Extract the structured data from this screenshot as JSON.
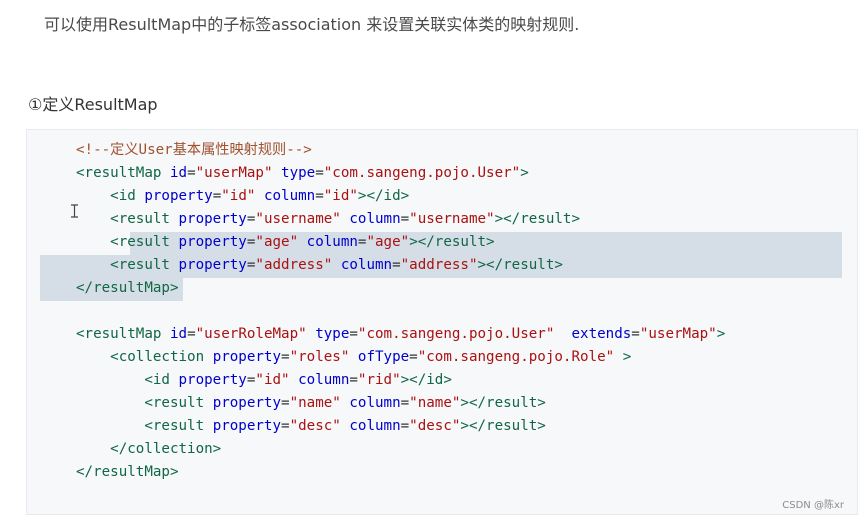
{
  "intro_text": "可以使用ResultMap中的子标签association 来设置关联实体类的映射规则.",
  "heading": "①定义ResultMap",
  "watermark": "CSDN @陈xr",
  "code_lines": [
    [
      [
        "comment",
        "<!--定义User基本属性映射规则-->"
      ]
    ],
    [
      [
        "tag",
        "<resultMap"
      ],
      [
        "plain",
        " "
      ],
      [
        "attr",
        "id"
      ],
      [
        "plain",
        "="
      ],
      [
        "val",
        "\"userMap\""
      ],
      [
        "plain",
        " "
      ],
      [
        "attr",
        "type"
      ],
      [
        "plain",
        "="
      ],
      [
        "val",
        "\"com.sangeng.pojo.User\""
      ],
      [
        "tag",
        ">"
      ]
    ],
    [
      [
        "plain",
        "    "
      ],
      [
        "tag",
        "<id"
      ],
      [
        "plain",
        " "
      ],
      [
        "attr",
        "property"
      ],
      [
        "plain",
        "="
      ],
      [
        "val",
        "\"id\""
      ],
      [
        "plain",
        " "
      ],
      [
        "attr",
        "column"
      ],
      [
        "plain",
        "="
      ],
      [
        "val",
        "\"id\""
      ],
      [
        "tag",
        "></id>"
      ]
    ],
    [
      [
        "plain",
        "    "
      ],
      [
        "tag",
        "<result"
      ],
      [
        "plain",
        " "
      ],
      [
        "attr",
        "property"
      ],
      [
        "plain",
        "="
      ],
      [
        "val",
        "\"username\""
      ],
      [
        "plain",
        " "
      ],
      [
        "attr",
        "column"
      ],
      [
        "plain",
        "="
      ],
      [
        "val",
        "\"username\""
      ],
      [
        "tag",
        "></result>"
      ]
    ],
    [
      [
        "plain",
        "    "
      ],
      [
        "tag",
        "<result"
      ],
      [
        "plain",
        " "
      ],
      [
        "attr",
        "property"
      ],
      [
        "plain",
        "="
      ],
      [
        "val",
        "\"age\""
      ],
      [
        "plain",
        " "
      ],
      [
        "attr",
        "column"
      ],
      [
        "plain",
        "="
      ],
      [
        "val",
        "\"age\""
      ],
      [
        "tag",
        "></result>"
      ]
    ],
    [
      [
        "plain",
        "    "
      ],
      [
        "tag",
        "<result"
      ],
      [
        "plain",
        " "
      ],
      [
        "attr",
        "property"
      ],
      [
        "plain",
        "="
      ],
      [
        "val",
        "\"address\""
      ],
      [
        "plain",
        " "
      ],
      [
        "attr",
        "column"
      ],
      [
        "plain",
        "="
      ],
      [
        "val",
        "\"address\""
      ],
      [
        "tag",
        "></result>"
      ]
    ],
    [
      [
        "tag",
        "</resultMap>"
      ]
    ],
    [],
    [
      [
        "tag",
        "<resultMap"
      ],
      [
        "plain",
        " "
      ],
      [
        "attr",
        "id"
      ],
      [
        "plain",
        "="
      ],
      [
        "val",
        "\"userRoleMap\""
      ],
      [
        "plain",
        " "
      ],
      [
        "attr",
        "type"
      ],
      [
        "plain",
        "="
      ],
      [
        "val",
        "\"com.sangeng.pojo.User\""
      ],
      [
        "plain",
        "  "
      ],
      [
        "attr",
        "extends"
      ],
      [
        "plain",
        "="
      ],
      [
        "val",
        "\"userMap\""
      ],
      [
        "tag",
        ">"
      ]
    ],
    [
      [
        "plain",
        "    "
      ],
      [
        "tag",
        "<collection"
      ],
      [
        "plain",
        " "
      ],
      [
        "attr",
        "property"
      ],
      [
        "plain",
        "="
      ],
      [
        "val",
        "\"roles\""
      ],
      [
        "plain",
        " "
      ],
      [
        "attr",
        "ofType"
      ],
      [
        "plain",
        "="
      ],
      [
        "val",
        "\"com.sangeng.pojo.Role\""
      ],
      [
        "plain",
        " "
      ],
      [
        "tag",
        ">"
      ]
    ],
    [
      [
        "plain",
        "        "
      ],
      [
        "tag",
        "<id"
      ],
      [
        "plain",
        " "
      ],
      [
        "attr",
        "property"
      ],
      [
        "plain",
        "="
      ],
      [
        "val",
        "\"id\""
      ],
      [
        "plain",
        " "
      ],
      [
        "attr",
        "column"
      ],
      [
        "plain",
        "="
      ],
      [
        "val",
        "\"rid\""
      ],
      [
        "tag",
        "></id>"
      ]
    ],
    [
      [
        "plain",
        "        "
      ],
      [
        "tag",
        "<result"
      ],
      [
        "plain",
        " "
      ],
      [
        "attr",
        "property"
      ],
      [
        "plain",
        "="
      ],
      [
        "val",
        "\"name\""
      ],
      [
        "plain",
        " "
      ],
      [
        "attr",
        "column"
      ],
      [
        "plain",
        "="
      ],
      [
        "val",
        "\"name\""
      ],
      [
        "tag",
        "></result>"
      ]
    ],
    [
      [
        "plain",
        "        "
      ],
      [
        "tag",
        "<result"
      ],
      [
        "plain",
        " "
      ],
      [
        "attr",
        "property"
      ],
      [
        "plain",
        "="
      ],
      [
        "val",
        "\"desc\""
      ],
      [
        "plain",
        " "
      ],
      [
        "attr",
        "column"
      ],
      [
        "plain",
        "="
      ],
      [
        "val",
        "\"desc\""
      ],
      [
        "tag",
        "></result>"
      ]
    ],
    [
      [
        "plain",
        "    "
      ],
      [
        "tag",
        "</collection>"
      ]
    ],
    [
      [
        "tag",
        "</resultMap>"
      ]
    ]
  ]
}
